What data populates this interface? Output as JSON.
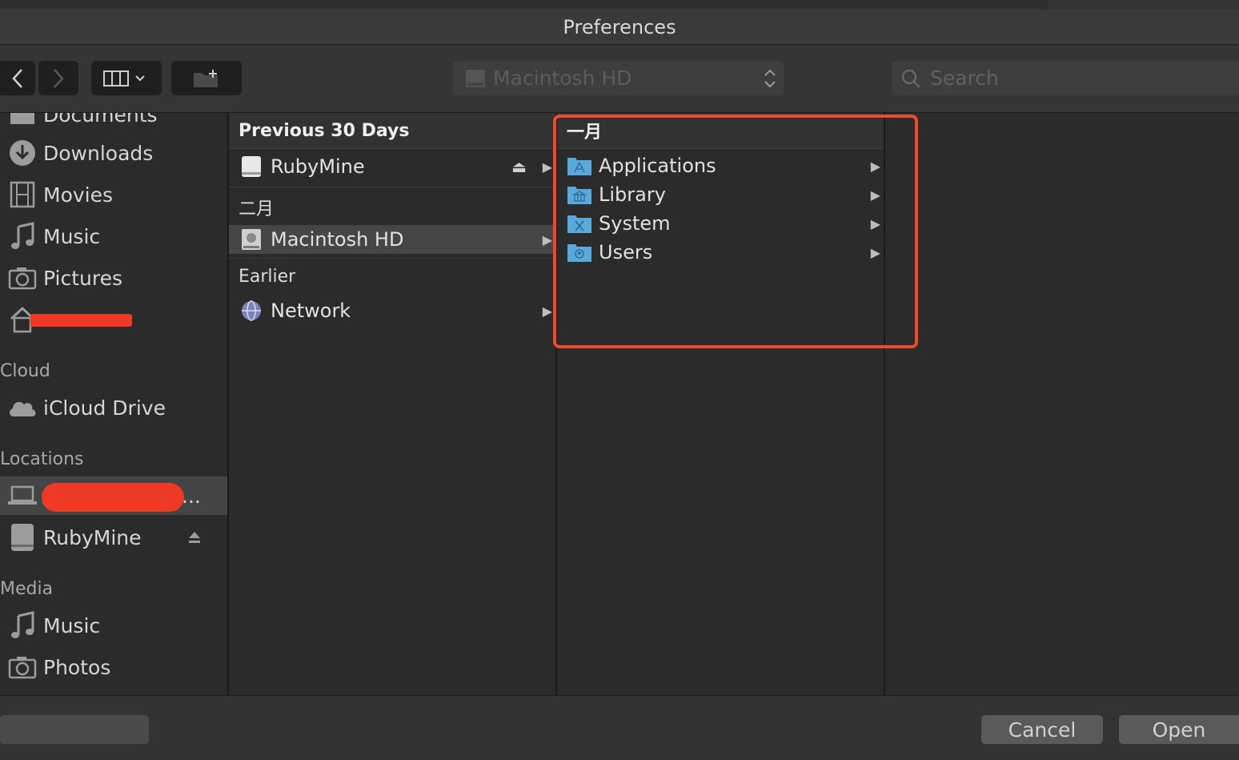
{
  "window": {
    "title": "Preferences"
  },
  "toolbar": {
    "location_popup": "Macintosh HD",
    "search_placeholder": "Search"
  },
  "sidebar": {
    "items_top": [
      {
        "label": "Documents",
        "icon": "folder-icon"
      },
      {
        "label": "Downloads",
        "icon": "download-icon"
      },
      {
        "label": "Movies",
        "icon": "film-icon"
      },
      {
        "label": "Music",
        "icon": "music-note-icon"
      },
      {
        "label": "Pictures",
        "icon": "camera-icon"
      },
      {
        "label": "",
        "icon": "home-icon"
      }
    ],
    "cloud_header": "Cloud",
    "cloud_items": [
      {
        "label": "iCloud Drive",
        "icon": "cloud-icon"
      }
    ],
    "locations_header": "Locations",
    "location_items": [
      {
        "label": "...",
        "icon": "laptop-icon"
      },
      {
        "label": "RubyMine",
        "icon": "disk-icon"
      }
    ],
    "media_header": "Media",
    "media_items": [
      {
        "label": "Music",
        "icon": "music-note-icon"
      },
      {
        "label": "Photos",
        "icon": "camera-icon"
      }
    ]
  },
  "column1": {
    "header": "Previous 30 Days",
    "group2": "二月",
    "group3": "Earlier",
    "rows": [
      {
        "label": "RubyMine",
        "icon": "disk-icon"
      },
      {
        "label": "Macintosh HD",
        "icon": "hard-drive-icon"
      },
      {
        "label": "Network",
        "icon": "globe-icon"
      }
    ]
  },
  "column2": {
    "header": "一月",
    "rows": [
      {
        "label": "Applications",
        "icon": "applications-folder-icon"
      },
      {
        "label": "Library",
        "icon": "library-folder-icon"
      },
      {
        "label": "System",
        "icon": "system-folder-icon"
      },
      {
        "label": "Users",
        "icon": "users-folder-icon"
      }
    ]
  },
  "buttons": {
    "cancel": "Cancel",
    "open": "Open"
  },
  "colors": {
    "highlight": "#ee4a2e",
    "folder": "#5aa9dc",
    "redaction": "#ee3a24"
  }
}
